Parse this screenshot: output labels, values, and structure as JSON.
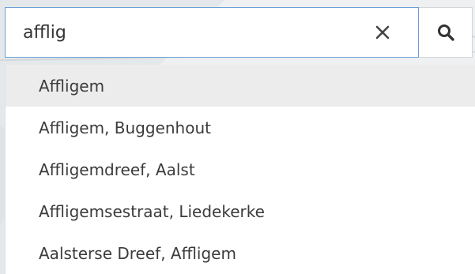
{
  "search": {
    "value": "afflig",
    "clear_icon": "close-icon",
    "search_icon": "search-icon"
  },
  "suggestions": [
    {
      "label": "Affligem",
      "highlighted": true
    },
    {
      "label": "Affligem, Buggenhout",
      "highlighted": false
    },
    {
      "label": "Affligemdreef, Aalst",
      "highlighted": false
    },
    {
      "label": "Affligemsestraat, Liedekerke",
      "highlighted": false
    },
    {
      "label": "Aalsterse Dreef, Affligem",
      "highlighted": false
    }
  ],
  "colors": {
    "focus_border": "#6aa0d6",
    "highlight_bg": "#ececec",
    "text": "#3b3b3b",
    "icon": "#333333"
  }
}
